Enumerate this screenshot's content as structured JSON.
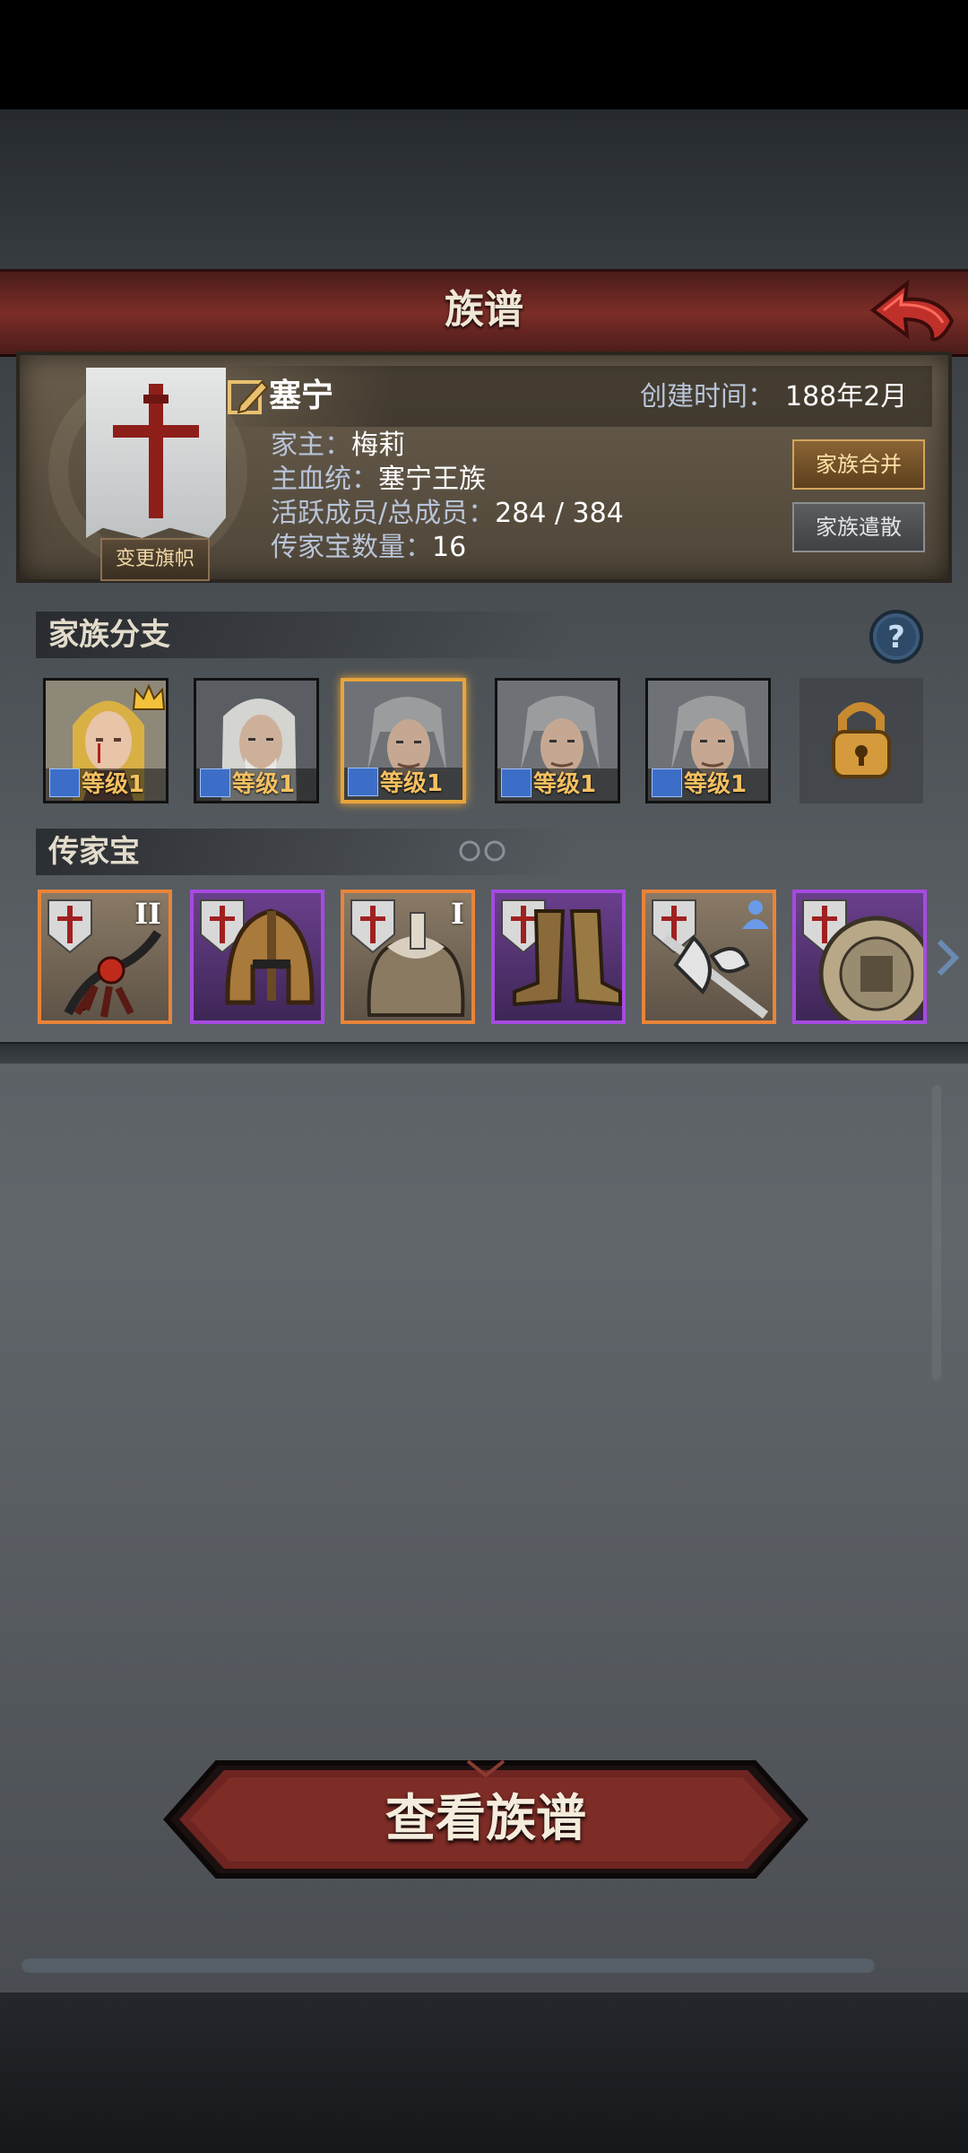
{
  "header": {
    "title": "族谱"
  },
  "family": {
    "name": "塞宁",
    "created_label": "创建时间：",
    "created_value": "188年2月",
    "head_label": "家主：",
    "head_value": "梅莉",
    "bloodline_label": "主血统：",
    "bloodline_value": "塞宁王族",
    "members_label": "活跃成员/总成员：",
    "members_value": "284 / 384",
    "heirloom_label": "传家宝数量：",
    "heirloom_value": "16",
    "change_banner": "变更旗帜",
    "merge_button": "家族合并",
    "disband_button": "家族遣散"
  },
  "branches": {
    "title": "家族分支",
    "members": [
      {
        "level": "等级1",
        "leader": true
      },
      {
        "level": "等级1"
      },
      {
        "level": "等级1",
        "selected": true
      },
      {
        "level": "等级1"
      },
      {
        "level": "等级1"
      }
    ]
  },
  "heirlooms": {
    "title": "传家宝",
    "items": [
      {
        "icon": "flail-icon",
        "rarity": "orange",
        "tier": "II"
      },
      {
        "icon": "helmet-icon",
        "rarity": "purple",
        "tier": ""
      },
      {
        "icon": "fur-coat-icon",
        "rarity": "orange",
        "tier": "I"
      },
      {
        "icon": "boots-icon",
        "rarity": "purple",
        "tier": ""
      },
      {
        "icon": "axe-icon",
        "rarity": "orange",
        "tier": ""
      },
      {
        "icon": "shield-icon",
        "rarity": "purple",
        "tier": ""
      }
    ]
  },
  "footer": {
    "view_button": "查看族谱"
  },
  "colors": {
    "accent": "#e8a43a",
    "title_bar": "#7c2d27",
    "orange_rarity": "#e8843a",
    "purple_rarity": "#a64ae0"
  }
}
